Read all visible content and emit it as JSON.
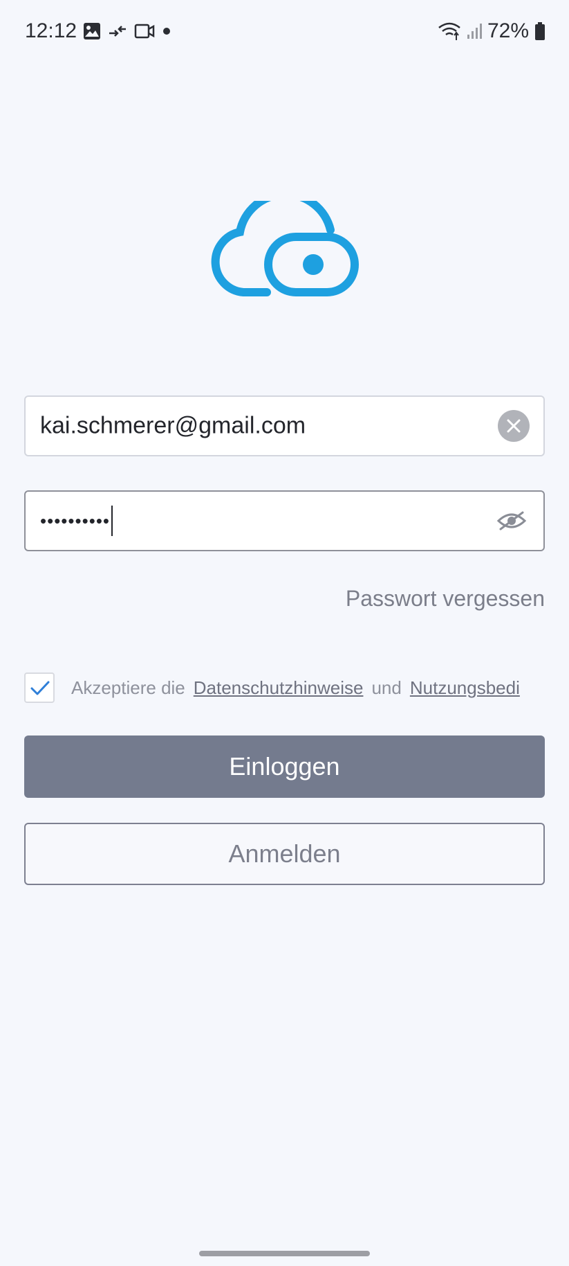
{
  "status_bar": {
    "time": "12:12",
    "battery": "72%",
    "left_icons": [
      "image-icon",
      "data-transfer-icon",
      "video-camera-icon",
      "dot-icon"
    ],
    "right_icons": [
      "wifi-icon",
      "signal-icon",
      "battery-icon"
    ]
  },
  "logo": {
    "icon": "cloud-eye-logo",
    "color": "#1ea0e0"
  },
  "login_form": {
    "email_value": "kai.schmerer@gmail.com",
    "password_value": "••••••••••",
    "forgot_password": "Passwort vergessen",
    "terms": {
      "checked": true,
      "prefix": "Akzeptiere die",
      "privacy_link": "Datenschutzhinweise",
      "conjunction": "und",
      "terms_link": "Nutzungsbedi"
    },
    "login_button": "Einloggen",
    "register_button": "Anmelden"
  },
  "colors": {
    "accent": "#1ea0e0",
    "login_button_bg": "#747b8e",
    "background": "#f5f7fc",
    "checkmark": "#2f7fd8"
  }
}
